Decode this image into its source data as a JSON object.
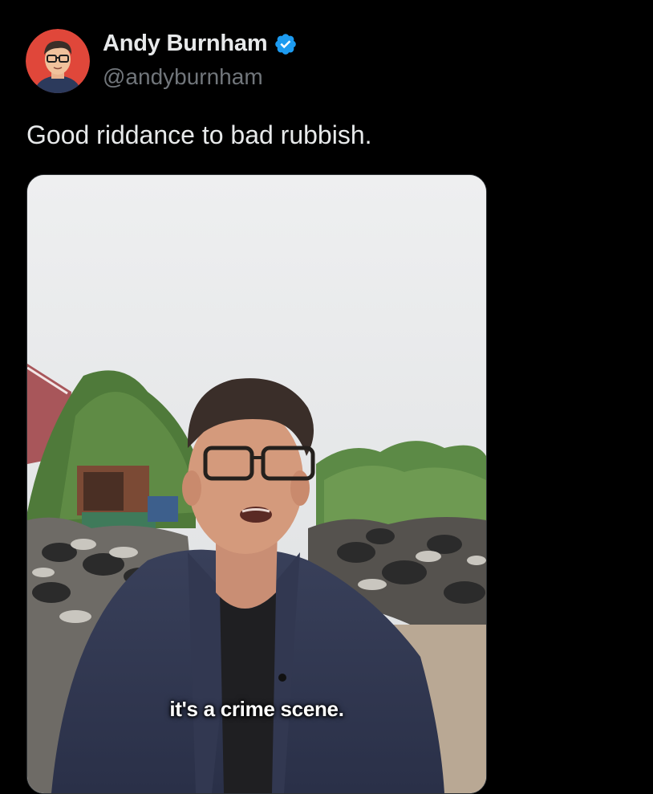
{
  "tweet": {
    "author": {
      "display_name": "Andy Burnham",
      "handle": "@andyburnham",
      "verified": true,
      "verified_color": "#1d9bf0",
      "avatar_icon": "cartoon-avatar"
    },
    "text": "Good riddance to bad rubbish.",
    "media": {
      "type": "video",
      "caption": "it's a crime scene."
    }
  },
  "colors": {
    "background": "#000000",
    "primary_text": "#e7e9ea",
    "secondary_text": "#71767b"
  }
}
